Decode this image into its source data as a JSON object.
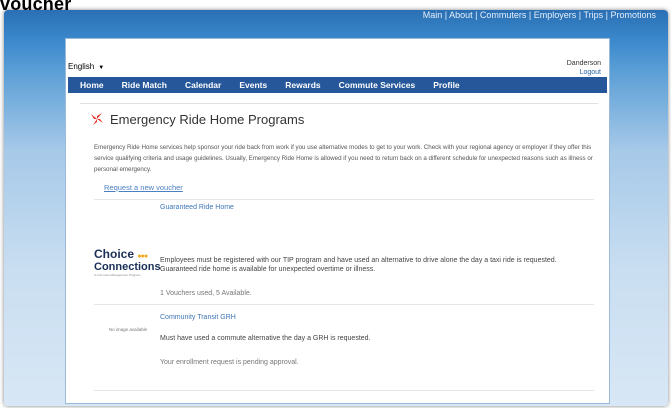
{
  "caption": "voucher",
  "top_links": "Main | About | Commuters | Employers | Trips | Promotions",
  "language": {
    "selected": "English",
    "caret": "▼"
  },
  "user": {
    "name": "Danderson",
    "logout": "Logout"
  },
  "nav": [
    "Home",
    "Ride Match",
    "Calendar",
    "Events",
    "Rewards",
    "Commute Services",
    "Profile"
  ],
  "page": {
    "title": "Emergency Ride Home Programs",
    "description": "Emergency Ride Home services help sponsor your ride back from work if you use alternative modes to get to your work. Check with your regional agency or employer if they offer this service qualifying criteria and usage guidelines. Usually, Emergency Ride Home is allowed if you need to return back on a different schedule for unexpected reasons such as illness or personal emergency.",
    "request_link": "Request a new voucher"
  },
  "programs": [
    {
      "title": "Guaranteed Ride Home",
      "logo": {
        "line1": "Choice",
        "line2": "Connections",
        "tagline": "A Commute Management Program"
      },
      "text": "Employees must be registered with our TIP program and have used an alternative to drive alone the day a taxi ride is requested. Guaranteed ride home is available for unexpected overtime or illness.",
      "status": "1 Vouchers used, 5 Available."
    },
    {
      "title": "Community Transit GRH",
      "no_image": "No image available",
      "text": "Must have used a commute alternative the day a GRH is requested.",
      "status": "Your enrollment request is pending approval."
    }
  ],
  "colors": {
    "nav_bg": "#25579a",
    "link": "#3d75b5",
    "logo_accent": "#e8342c"
  }
}
